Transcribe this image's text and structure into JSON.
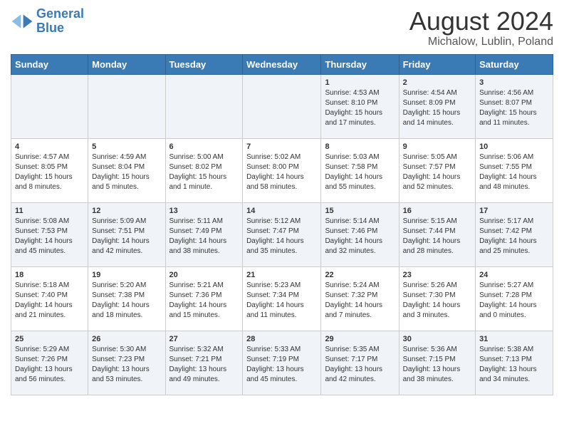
{
  "header": {
    "logo_line1": "General",
    "logo_line2": "Blue",
    "main_title": "August 2024",
    "subtitle": "Michalow, Lublin, Poland"
  },
  "calendar": {
    "weekdays": [
      "Sunday",
      "Monday",
      "Tuesday",
      "Wednesday",
      "Thursday",
      "Friday",
      "Saturday"
    ],
    "weeks": [
      [
        {
          "day": "",
          "info": ""
        },
        {
          "day": "",
          "info": ""
        },
        {
          "day": "",
          "info": ""
        },
        {
          "day": "",
          "info": ""
        },
        {
          "day": "1",
          "info": "Sunrise: 4:53 AM\nSunset: 8:10 PM\nDaylight: 15 hours and 17 minutes."
        },
        {
          "day": "2",
          "info": "Sunrise: 4:54 AM\nSunset: 8:09 PM\nDaylight: 15 hours and 14 minutes."
        },
        {
          "day": "3",
          "info": "Sunrise: 4:56 AM\nSunset: 8:07 PM\nDaylight: 15 hours and 11 minutes."
        }
      ],
      [
        {
          "day": "4",
          "info": "Sunrise: 4:57 AM\nSunset: 8:05 PM\nDaylight: 15 hours and 8 minutes."
        },
        {
          "day": "5",
          "info": "Sunrise: 4:59 AM\nSunset: 8:04 PM\nDaylight: 15 hours and 5 minutes."
        },
        {
          "day": "6",
          "info": "Sunrise: 5:00 AM\nSunset: 8:02 PM\nDaylight: 15 hours and 1 minute."
        },
        {
          "day": "7",
          "info": "Sunrise: 5:02 AM\nSunset: 8:00 PM\nDaylight: 14 hours and 58 minutes."
        },
        {
          "day": "8",
          "info": "Sunrise: 5:03 AM\nSunset: 7:58 PM\nDaylight: 14 hours and 55 minutes."
        },
        {
          "day": "9",
          "info": "Sunrise: 5:05 AM\nSunset: 7:57 PM\nDaylight: 14 hours and 52 minutes."
        },
        {
          "day": "10",
          "info": "Sunrise: 5:06 AM\nSunset: 7:55 PM\nDaylight: 14 hours and 48 minutes."
        }
      ],
      [
        {
          "day": "11",
          "info": "Sunrise: 5:08 AM\nSunset: 7:53 PM\nDaylight: 14 hours and 45 minutes."
        },
        {
          "day": "12",
          "info": "Sunrise: 5:09 AM\nSunset: 7:51 PM\nDaylight: 14 hours and 42 minutes."
        },
        {
          "day": "13",
          "info": "Sunrise: 5:11 AM\nSunset: 7:49 PM\nDaylight: 14 hours and 38 minutes."
        },
        {
          "day": "14",
          "info": "Sunrise: 5:12 AM\nSunset: 7:47 PM\nDaylight: 14 hours and 35 minutes."
        },
        {
          "day": "15",
          "info": "Sunrise: 5:14 AM\nSunset: 7:46 PM\nDaylight: 14 hours and 32 minutes."
        },
        {
          "day": "16",
          "info": "Sunrise: 5:15 AM\nSunset: 7:44 PM\nDaylight: 14 hours and 28 minutes."
        },
        {
          "day": "17",
          "info": "Sunrise: 5:17 AM\nSunset: 7:42 PM\nDaylight: 14 hours and 25 minutes."
        }
      ],
      [
        {
          "day": "18",
          "info": "Sunrise: 5:18 AM\nSunset: 7:40 PM\nDaylight: 14 hours and 21 minutes."
        },
        {
          "day": "19",
          "info": "Sunrise: 5:20 AM\nSunset: 7:38 PM\nDaylight: 14 hours and 18 minutes."
        },
        {
          "day": "20",
          "info": "Sunrise: 5:21 AM\nSunset: 7:36 PM\nDaylight: 14 hours and 15 minutes."
        },
        {
          "day": "21",
          "info": "Sunrise: 5:23 AM\nSunset: 7:34 PM\nDaylight: 14 hours and 11 minutes."
        },
        {
          "day": "22",
          "info": "Sunrise: 5:24 AM\nSunset: 7:32 PM\nDaylight: 14 hours and 7 minutes."
        },
        {
          "day": "23",
          "info": "Sunrise: 5:26 AM\nSunset: 7:30 PM\nDaylight: 14 hours and 3 minutes."
        },
        {
          "day": "24",
          "info": "Sunrise: 5:27 AM\nSunset: 7:28 PM\nDaylight: 14 hours and 0 minutes."
        }
      ],
      [
        {
          "day": "25",
          "info": "Sunrise: 5:29 AM\nSunset: 7:26 PM\nDaylight: 13 hours and 56 minutes."
        },
        {
          "day": "26",
          "info": "Sunrise: 5:30 AM\nSunset: 7:23 PM\nDaylight: 13 hours and 53 minutes."
        },
        {
          "day": "27",
          "info": "Sunrise: 5:32 AM\nSunset: 7:21 PM\nDaylight: 13 hours and 49 minutes."
        },
        {
          "day": "28",
          "info": "Sunrise: 5:33 AM\nSunset: 7:19 PM\nDaylight: 13 hours and 45 minutes."
        },
        {
          "day": "29",
          "info": "Sunrise: 5:35 AM\nSunset: 7:17 PM\nDaylight: 13 hours and 42 minutes."
        },
        {
          "day": "30",
          "info": "Sunrise: 5:36 AM\nSunset: 7:15 PM\nDaylight: 13 hours and 38 minutes."
        },
        {
          "day": "31",
          "info": "Sunrise: 5:38 AM\nSunset: 7:13 PM\nDaylight: 13 hours and 34 minutes."
        }
      ]
    ]
  }
}
